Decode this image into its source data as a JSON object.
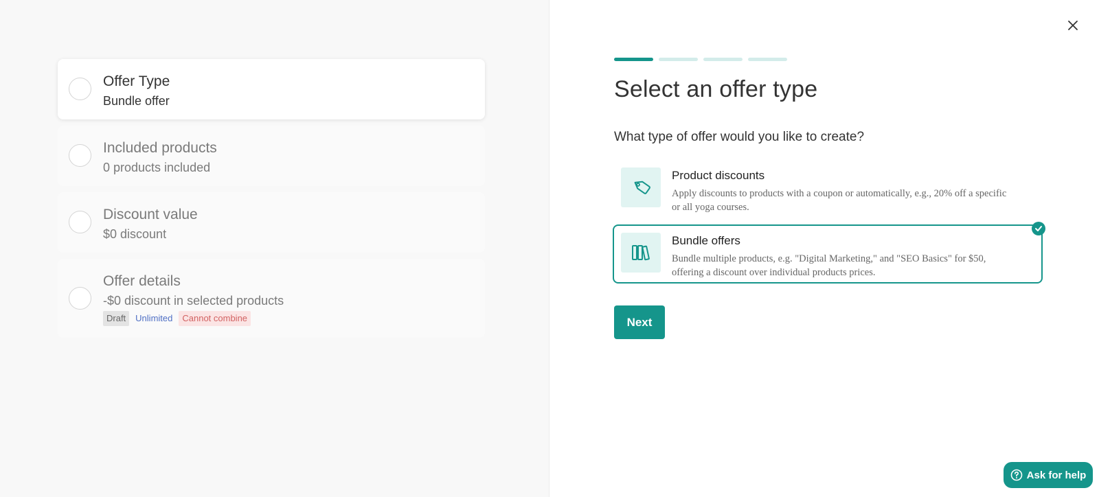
{
  "steps": [
    {
      "title": "Offer Type",
      "subtitle": "Bundle offer",
      "active": true
    },
    {
      "title": "Included products",
      "subtitle": "0 products included",
      "active": false
    },
    {
      "title": "Discount value",
      "subtitle": "$0 discount",
      "active": false
    },
    {
      "title": "Offer details",
      "subtitle": "-$0 discount in selected products",
      "active": false,
      "badges": [
        "Draft",
        "Unlimited",
        "Cannot combine"
      ]
    }
  ],
  "progress": {
    "current_step": 1,
    "total_steps": 4
  },
  "main": {
    "title": "Select an offer type",
    "question": "What type of offer would you like to create?",
    "options": [
      {
        "title": "Product discounts",
        "description": "Apply discounts to products with a coupon or automatically, e.g., 20% off a specific or all yoga courses.",
        "icon": "tag-icon",
        "selected": false
      },
      {
        "title": "Bundle offers",
        "description": "Bundle multiple products, e.g. \"Digital Marketing,\" and \"SEO Basics\" for $50, offering a discount over individual products prices.",
        "icon": "books-icon",
        "selected": true
      }
    ],
    "next_label": "Next"
  },
  "help": {
    "label": "Ask for help",
    "icon": "question-circle-icon"
  },
  "close_icon": "close-icon",
  "colors": {
    "accent": "#15958b",
    "accent_light": "#e1f4f2",
    "progress_inactive": "#d3ecea",
    "badge_red_bg": "#fbe4e4",
    "badge_red_text": "#d26262",
    "badge_blue_text": "#4f6fc4"
  }
}
